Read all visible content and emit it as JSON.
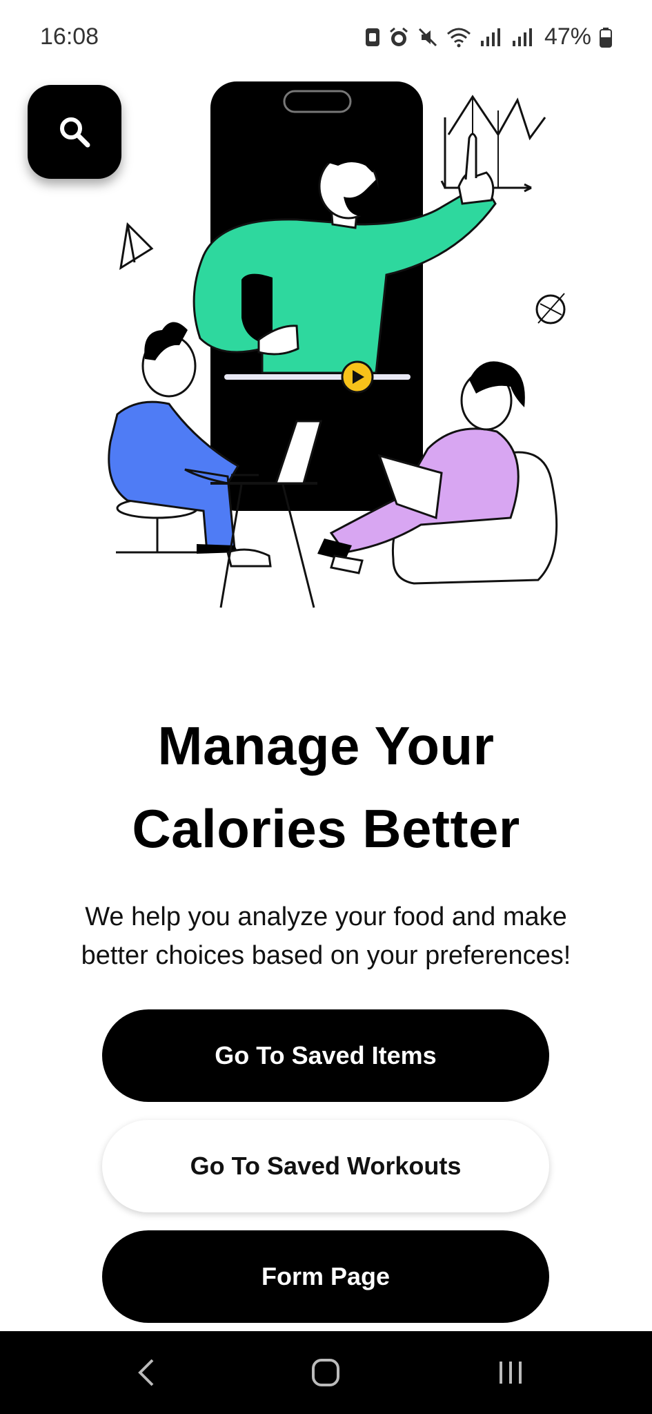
{
  "status_bar": {
    "time": "16:08",
    "battery": "47%",
    "icons": [
      "sim-icon",
      "alarm-icon",
      "mute-icon",
      "wifi-icon",
      "signal-icon",
      "signal-icon",
      "battery-icon"
    ]
  },
  "search": {
    "icon": "search-icon"
  },
  "hero": {
    "title_line1": "Manage Your",
    "title_line2": "Calories Better",
    "subtitle_line1": "We help you analyze your food and make",
    "subtitle_line2": "better choices based on your preferences!"
  },
  "actions": {
    "saved_items": "Go To Saved Items",
    "saved_workouts": "Go To Saved Workouts",
    "form_page": "Form Page"
  },
  "nav": {
    "back": "back-icon",
    "home": "home-icon",
    "recents": "recents-icon"
  },
  "colors": {
    "background": "#ffffff",
    "button_dark": "#000000",
    "accent_green": "#2ed89e",
    "accent_blue": "#4f7cf5",
    "accent_purple": "#d8a6f2",
    "accent_yellow": "#f7c21a"
  }
}
